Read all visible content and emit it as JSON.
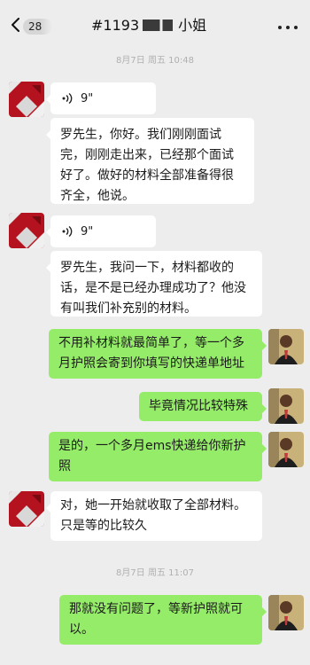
{
  "colors": {
    "background": "#ededed",
    "incoming_bubble": "#ffffff",
    "outgoing_bubble": "#95ec69",
    "avatar_red": "#b4121f"
  },
  "header": {
    "unread_count": "28",
    "title_prefix": "#1193",
    "title_suffix": "小姐",
    "back_icon": "chevron-left-icon",
    "more_icon": "more-dots-icon"
  },
  "timestamps": [
    "8月7日 周五 10:48",
    "8月7日 周五 11:07"
  ],
  "messages": [
    {
      "side": "in",
      "type": "voice",
      "duration": "9\""
    },
    {
      "side": "in",
      "type": "text",
      "text": "罗先生，你好。我们刚刚面试完，刚刚走出来，已经那个面试好了。做好的材料全部准备得很齐全，他说。"
    },
    {
      "side": "in",
      "type": "voice",
      "duration": "9\""
    },
    {
      "side": "in",
      "type": "text",
      "text": "罗先生，我问一下，材料都收的话，是不是已经办理成功了？他没有叫我们补充别的材料。"
    },
    {
      "side": "out",
      "type": "text",
      "text": "不用补材料就最简单了，等一个多月护照会寄到你填写的快递单地址"
    },
    {
      "side": "out",
      "type": "text",
      "text": "毕竟情况比较特殊"
    },
    {
      "side": "out",
      "type": "text",
      "text": "是的，一个多月ems快递给你新护照"
    },
    {
      "side": "in",
      "type": "text",
      "text": "对，她一开始就收取了全部材料。只是等的比较久"
    },
    {
      "side": "out",
      "type": "text",
      "text": "那就没有问题了，等新护照就可以。"
    }
  ]
}
